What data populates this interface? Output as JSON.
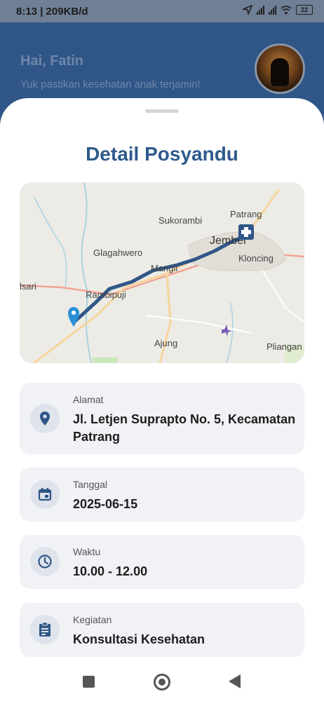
{
  "status_bar": {
    "time": "8:13 | 209KB/d",
    "battery": "22"
  },
  "header": {
    "greeting": "Hai, Fatin",
    "subtitle": "Yuk pastikan kesehatan anak terjamin!"
  },
  "page_title": "Detail Posyandu",
  "map": {
    "labels": [
      "Patrang",
      "Sukorambi",
      "Jember",
      "Glagahwero",
      "Kloncing",
      "Mangli",
      "Rambipuji",
      "lsari",
      "Ajung",
      "Pliangan"
    ],
    "route_color": "#2f5687"
  },
  "details": [
    {
      "icon": "location-pin-icon",
      "label": "Alamat",
      "value": "Jl. Letjen Suprapto No. 5, Kecamatan Patrang"
    },
    {
      "icon": "calendar-icon",
      "label": "Tanggal",
      "value": "2025-06-15"
    },
    {
      "icon": "clock-icon",
      "label": "Waktu",
      "value": "10.00 - 12.00"
    },
    {
      "icon": "clipboard-icon",
      "label": "Kegiatan",
      "value": "Konsultasi Kesehatan"
    }
  ]
}
